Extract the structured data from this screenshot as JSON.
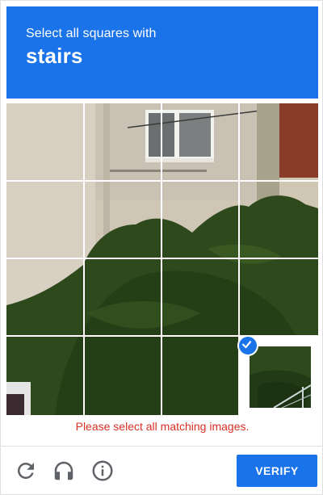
{
  "header": {
    "instruction": "Select all squares with",
    "target": "stairs",
    "background_color": "#1a73e8"
  },
  "grid": {
    "rows": 4,
    "columns": 4,
    "tiles": [
      {
        "row": 1,
        "col": 1,
        "selected": false
      },
      {
        "row": 1,
        "col": 2,
        "selected": false
      },
      {
        "row": 1,
        "col": 3,
        "selected": false
      },
      {
        "row": 1,
        "col": 4,
        "selected": false
      },
      {
        "row": 2,
        "col": 1,
        "selected": false
      },
      {
        "row": 2,
        "col": 2,
        "selected": false
      },
      {
        "row": 2,
        "col": 3,
        "selected": false
      },
      {
        "row": 2,
        "col": 4,
        "selected": false
      },
      {
        "row": 3,
        "col": 1,
        "selected": false
      },
      {
        "row": 3,
        "col": 2,
        "selected": false
      },
      {
        "row": 3,
        "col": 3,
        "selected": false
      },
      {
        "row": 3,
        "col": 4,
        "selected": false
      },
      {
        "row": 4,
        "col": 1,
        "selected": false
      },
      {
        "row": 4,
        "col": 2,
        "selected": false
      },
      {
        "row": 4,
        "col": 3,
        "selected": false
      },
      {
        "row": 4,
        "col": 4,
        "selected": true
      }
    ]
  },
  "error_message": "Please select all matching images.",
  "error_color": "#d93025",
  "footer": {
    "icons": [
      "reload-icon",
      "audio-icon",
      "info-icon"
    ],
    "verify_label": "VERIFY",
    "verify_color": "#1a73e8"
  }
}
